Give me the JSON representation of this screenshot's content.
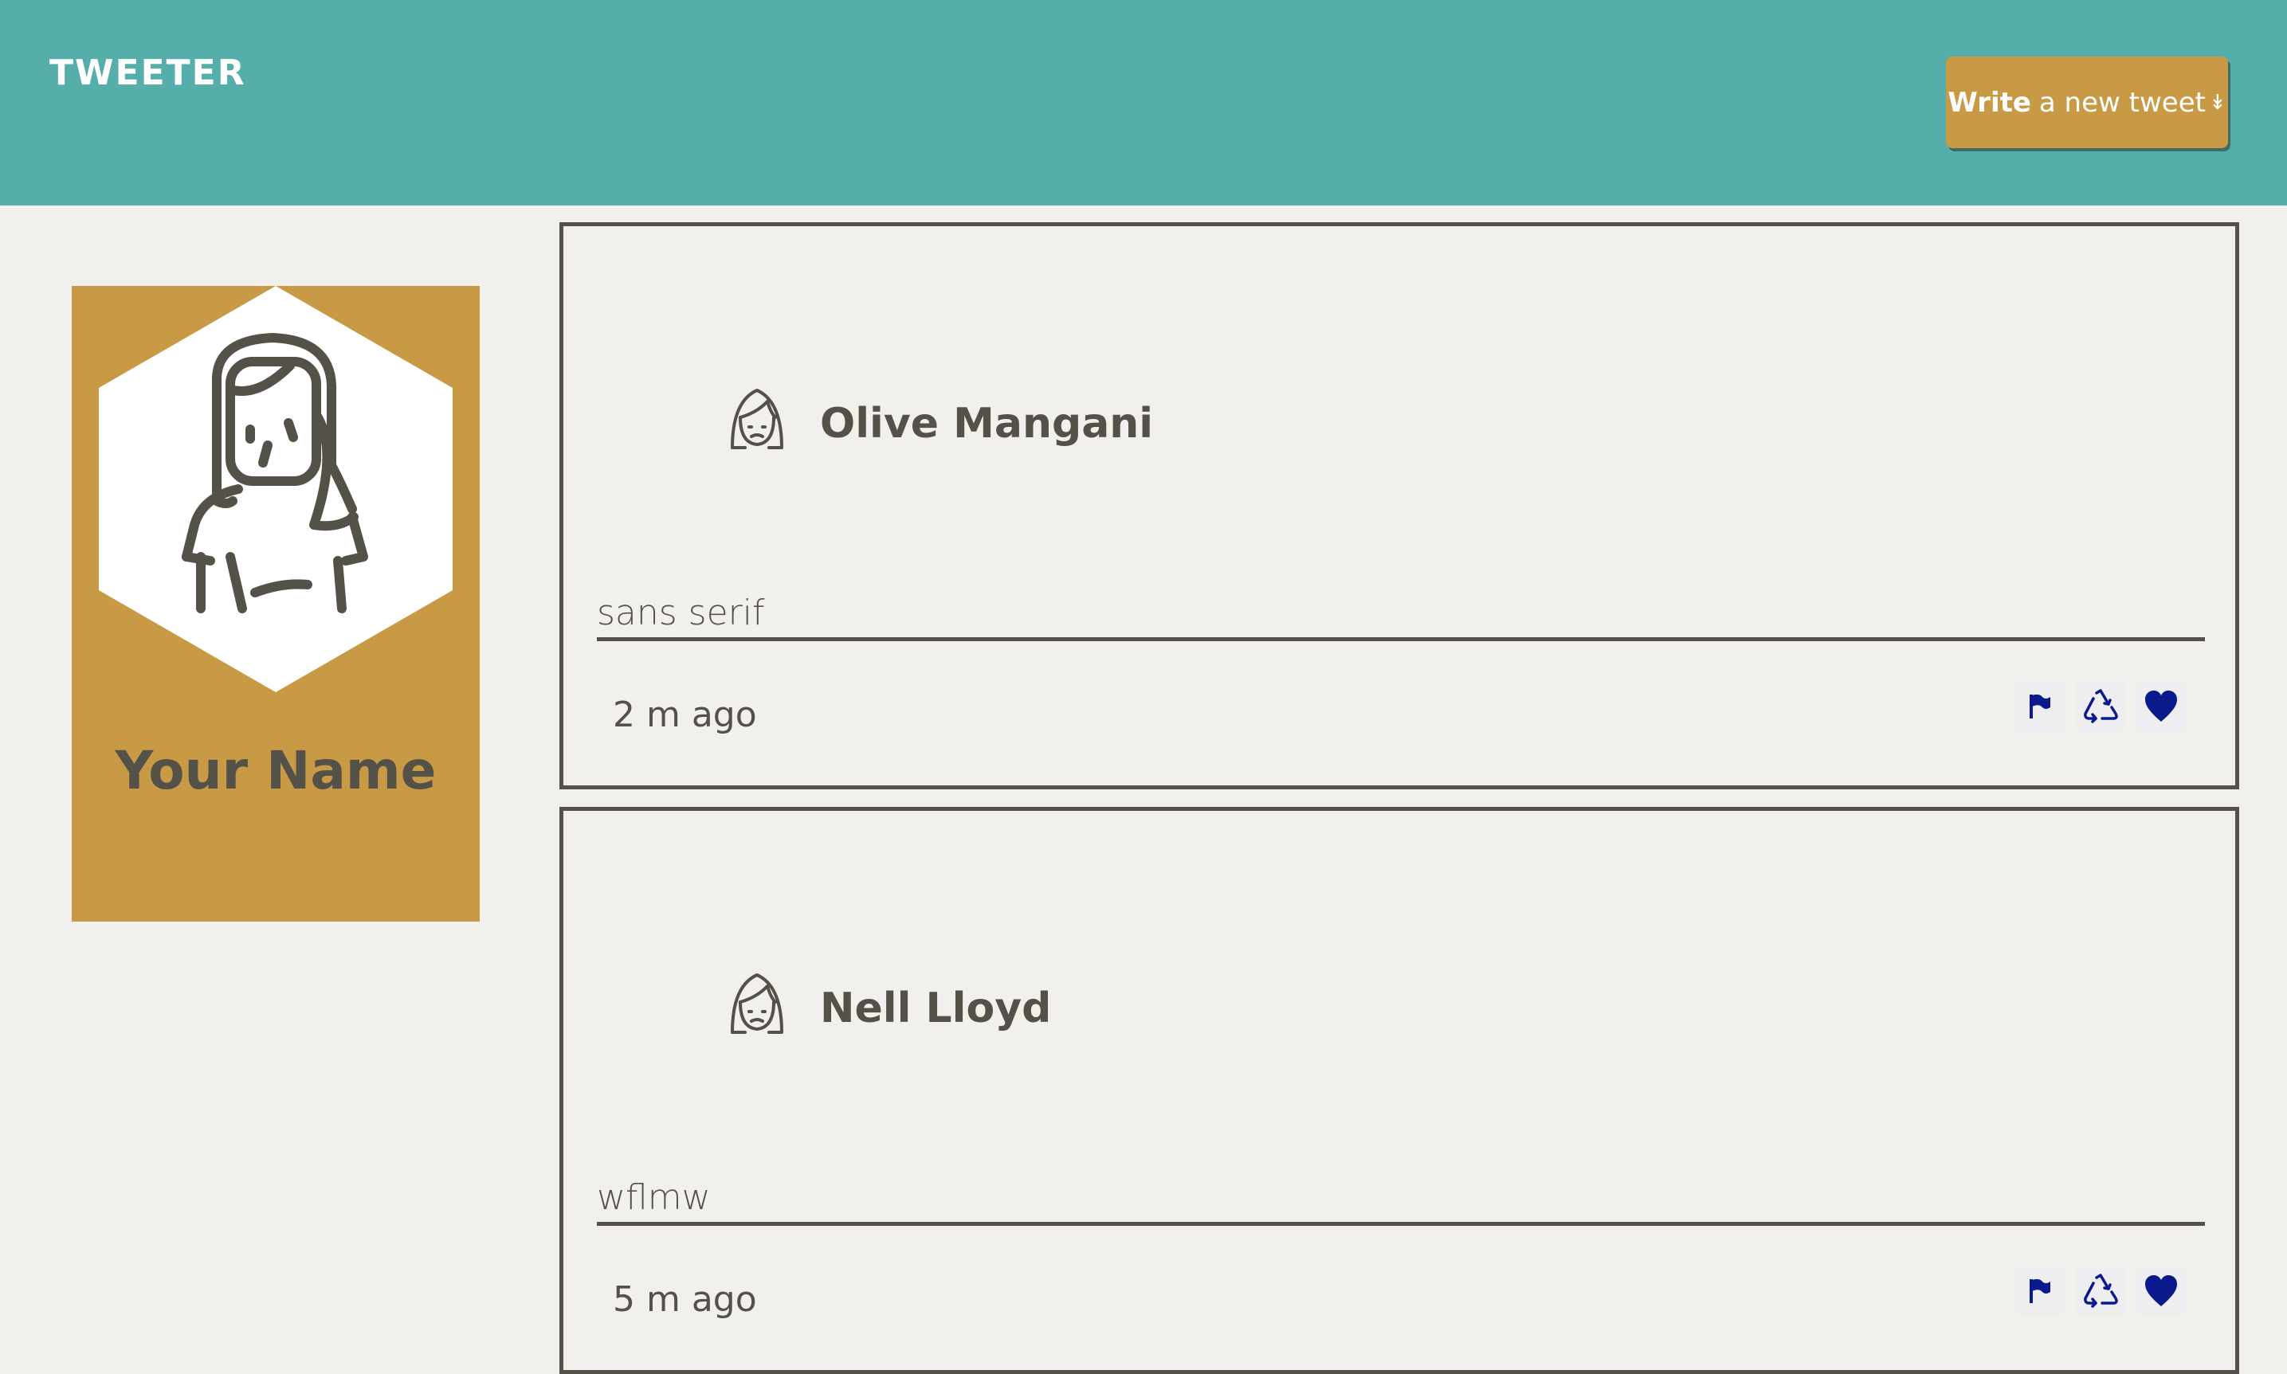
{
  "header": {
    "brand": "TWEETER",
    "compose_button": {
      "strong": "Write",
      "rest": "a new tweet",
      "arrow": "↡"
    }
  },
  "profile": {
    "name": "Your Name",
    "avatar_icon": "woman-avatar-icon"
  },
  "tweets": [
    {
      "author": "Olive Mangani",
      "content": "sans serif",
      "time": "2 m ago",
      "actions": [
        "flag-icon",
        "retweet-icon",
        "heart-icon"
      ]
    },
    {
      "author": "Nell Lloyd",
      "content": "wflmw",
      "time": "5 m ago",
      "actions": [
        "flag-icon",
        "retweet-icon",
        "heart-icon"
      ]
    }
  ],
  "colors": {
    "header_bg": "#55aea9",
    "accent": "#c99a45",
    "text": "#545149",
    "page_bg": "#f2f0ec",
    "action_icon": "#0a1a8c"
  }
}
